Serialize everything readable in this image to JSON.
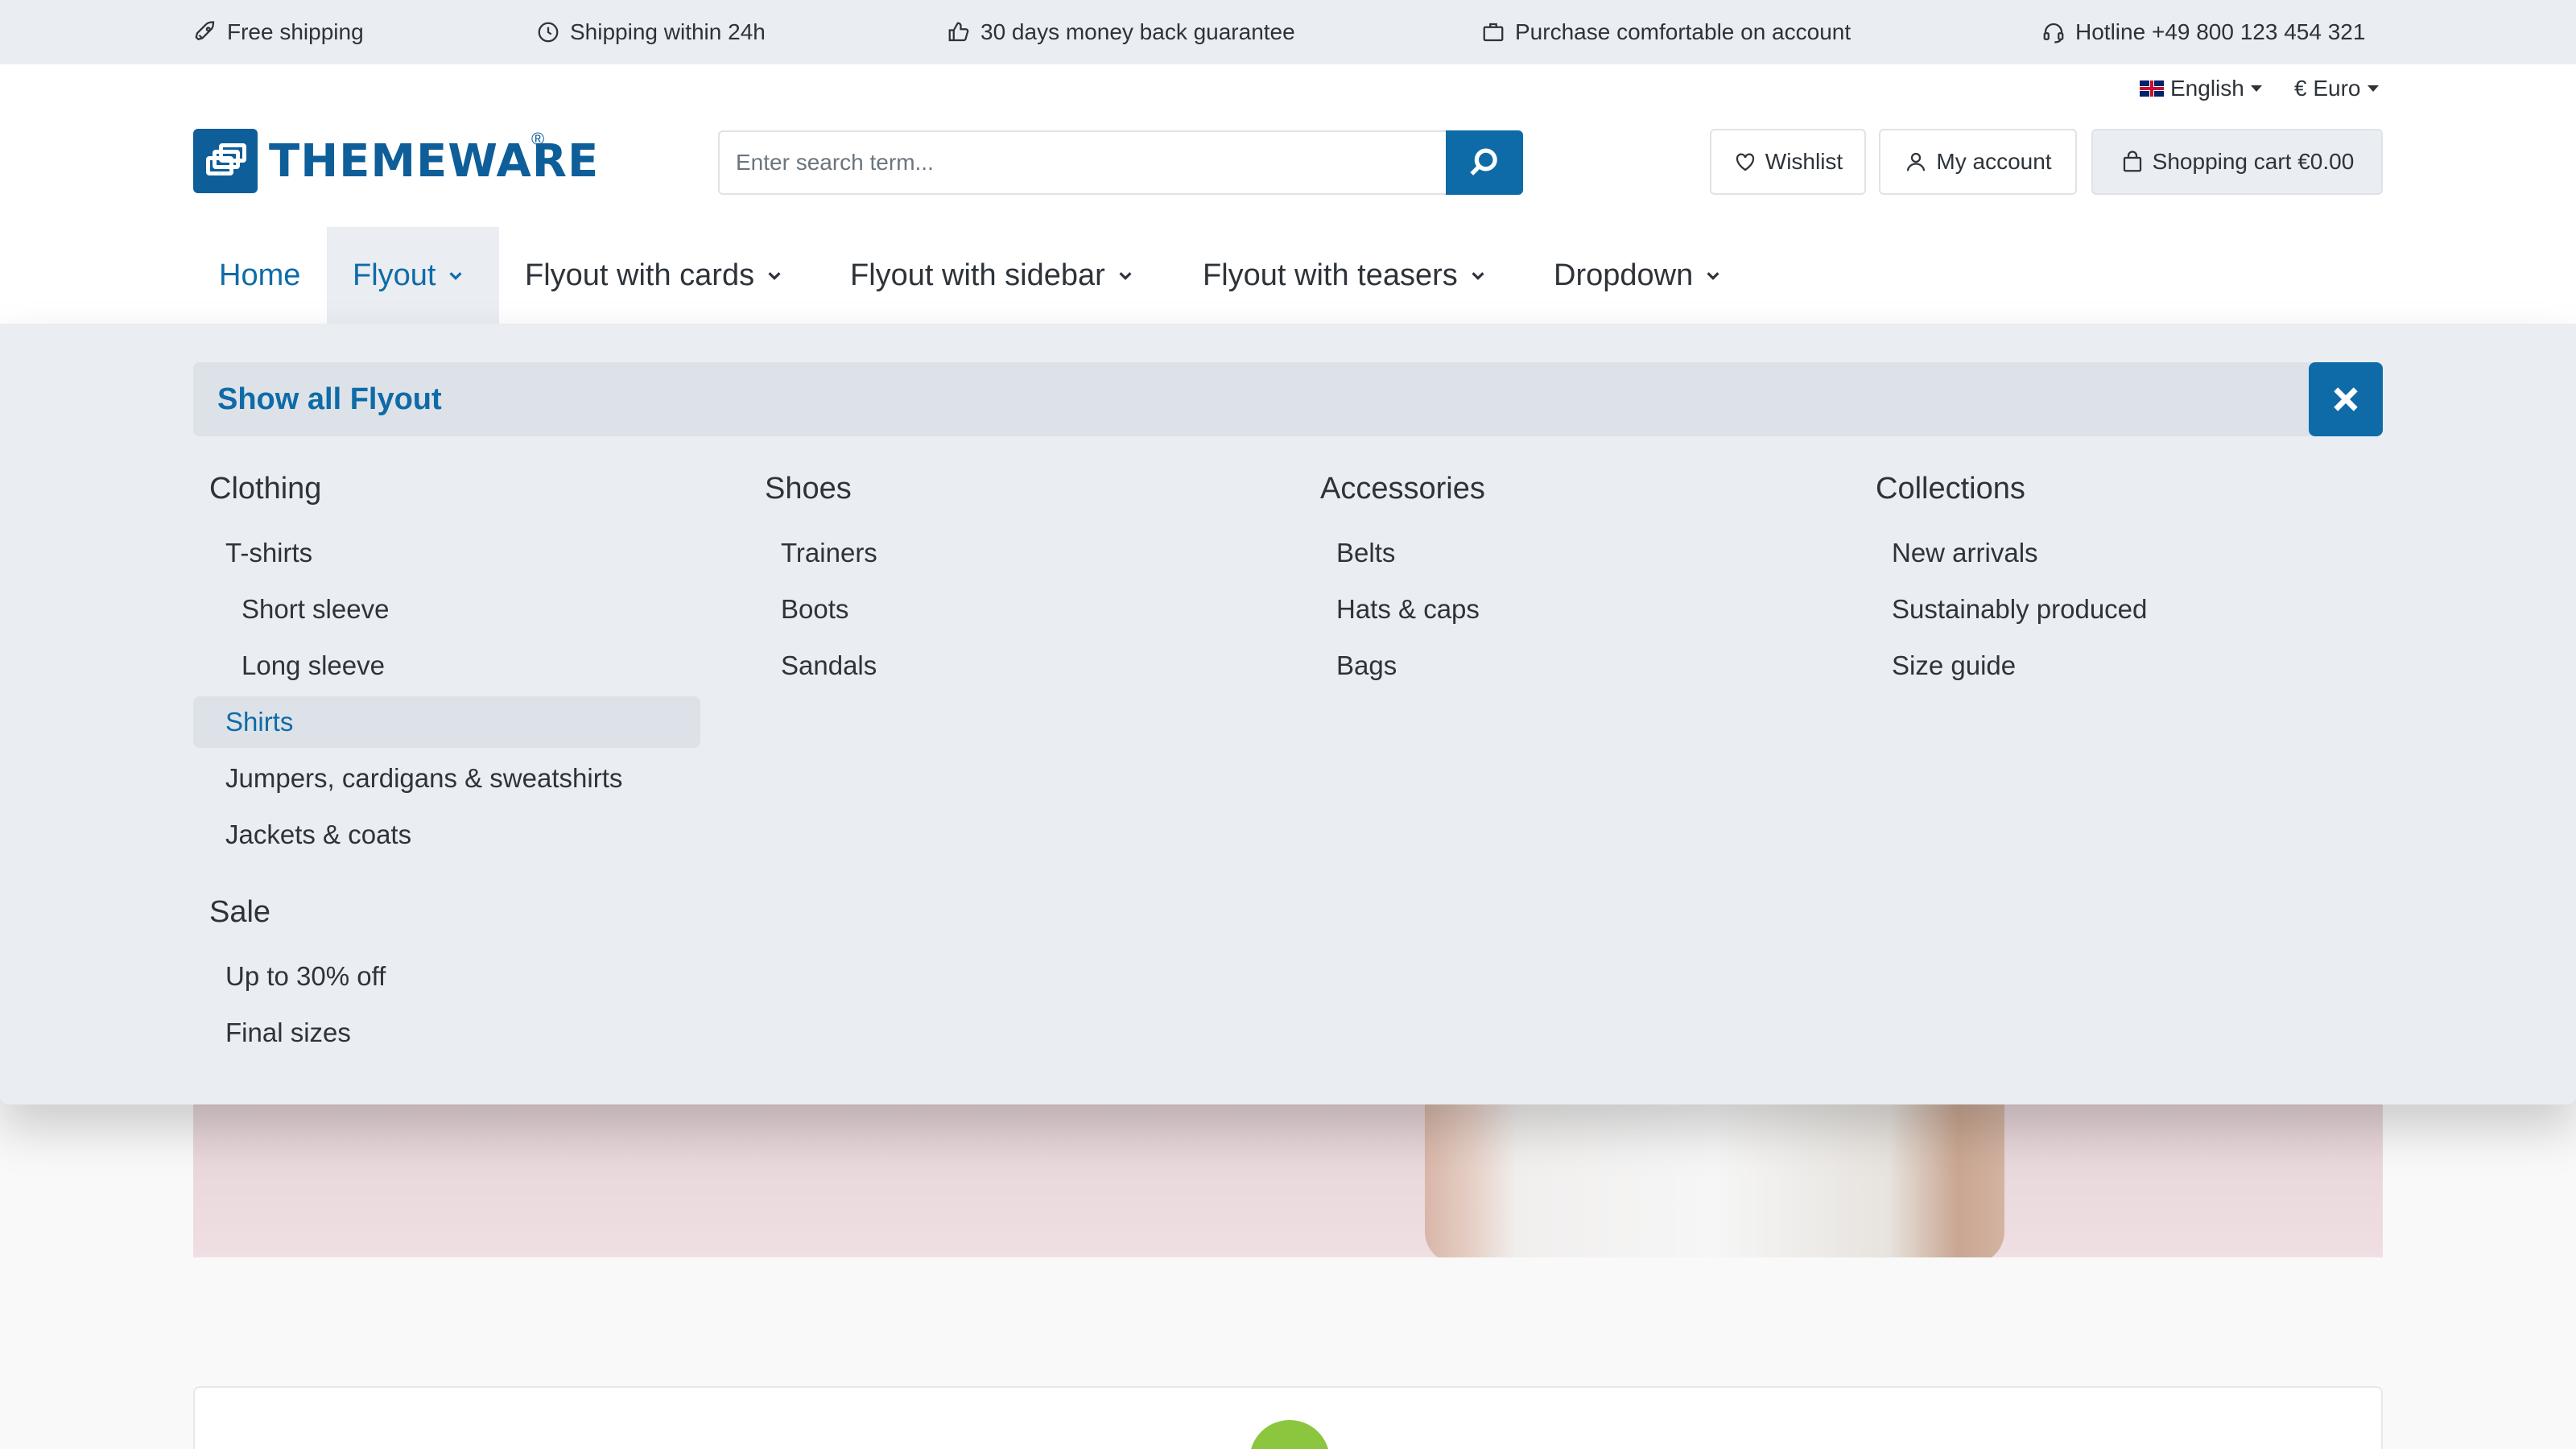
{
  "topbar": {
    "usps": [
      {
        "icon": "rocket-icon",
        "label": "Free shipping"
      },
      {
        "icon": "clock-icon",
        "label": "Shipping within 24h"
      },
      {
        "icon": "thumbs-up-icon",
        "label": "30 days money back guarantee"
      },
      {
        "icon": "briefcase-icon",
        "label": "Purchase comfortable on account"
      },
      {
        "icon": "headset-icon",
        "label": "Hotline +49 800 123 454 321"
      }
    ]
  },
  "header": {
    "language": "English",
    "currency": "€ Euro",
    "logo_text": "THEMEWARE",
    "logo_reg": "®",
    "search_placeholder": "Enter search term...",
    "wishlist_label": "Wishlist",
    "account_label": "My account",
    "cart_label": "Shopping cart €0.00"
  },
  "nav": {
    "items": [
      {
        "label": "Home"
      },
      {
        "label": "Flyout"
      },
      {
        "label": "Flyout with cards"
      },
      {
        "label": "Flyout with sidebar"
      },
      {
        "label": "Flyout with teasers"
      },
      {
        "label": "Dropdown"
      }
    ]
  },
  "flyout": {
    "show_all": "Show all Flyout",
    "columns": [
      {
        "title": "Clothing",
        "links": [
          "T-shirts",
          "Short sleeve",
          "Long sleeve",
          "Shirts",
          "Jumpers, cardigans & sweatshirts",
          "Jackets & coats"
        ]
      },
      {
        "title": "Shoes",
        "links": [
          "Trainers",
          "Boots",
          "Sandals"
        ]
      },
      {
        "title": "Accessories",
        "links": [
          "Belts",
          "Hats & caps",
          "Bags"
        ]
      },
      {
        "title": "Collections",
        "links": [
          "New arrivals",
          "Sustainably produced",
          "Size guide"
        ]
      }
    ],
    "sale": {
      "title": "Sale",
      "links": [
        "Up to 30% off",
        "Final sizes"
      ]
    }
  },
  "colors": {
    "primary": "#0e6ba8",
    "topbar_bg": "#eaedf1",
    "text": "#2d3339"
  }
}
